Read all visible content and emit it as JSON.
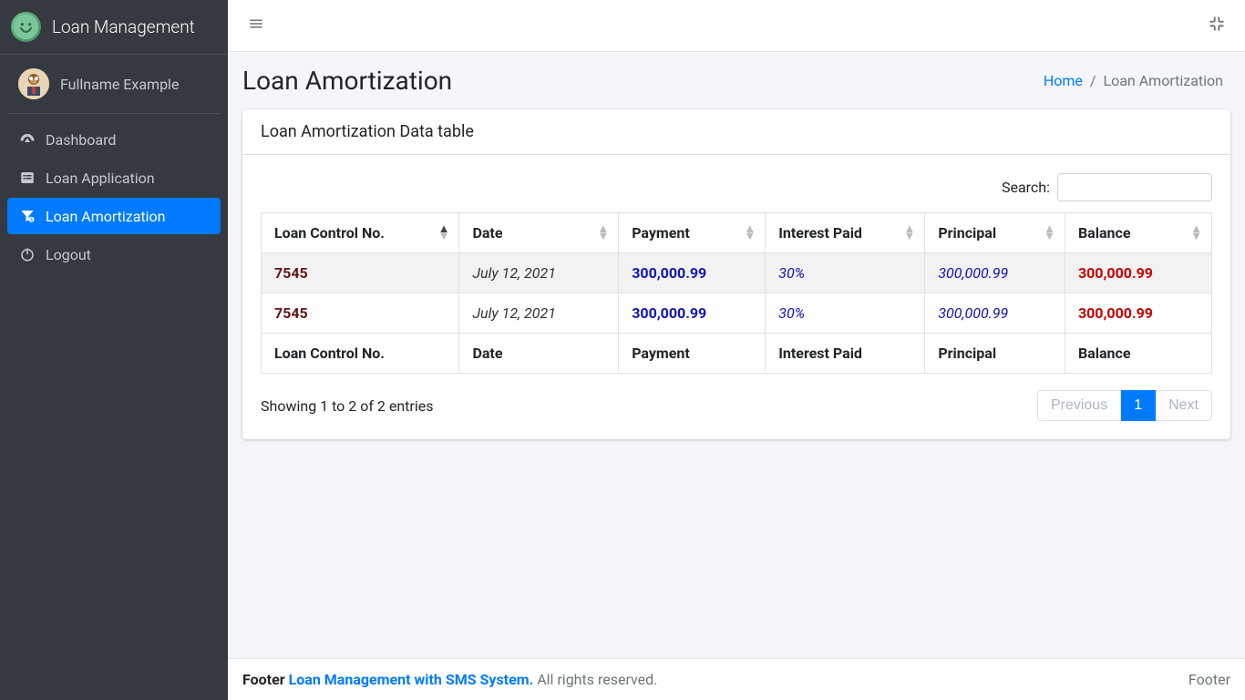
{
  "brand": {
    "name": "Loan Management"
  },
  "user": {
    "fullname": "Fullname Example"
  },
  "sidebar": {
    "items": [
      {
        "label": "Dashboard"
      },
      {
        "label": "Loan Application"
      },
      {
        "label": "Loan Amortization"
      },
      {
        "label": "Logout"
      }
    ]
  },
  "header": {
    "title": "Loan Amortization",
    "breadcrumb_home": "Home",
    "breadcrumb_current": "Loan Amortization"
  },
  "card": {
    "title": "Loan Amortization Data table"
  },
  "datatable": {
    "search_label": "Search:",
    "columns": [
      "Loan Control No.",
      "Date",
      "Payment",
      "Interest Paid",
      "Principal",
      "Balance"
    ],
    "rows": [
      {
        "control": "7545",
        "date": "July 12, 2021",
        "payment": "300,000.99",
        "interest": "30%",
        "principal": "300,000.99",
        "balance": "300,000.99"
      },
      {
        "control": "7545",
        "date": "July 12, 2021",
        "payment": "300,000.99",
        "interest": "30%",
        "principal": "300,000.99",
        "balance": "300,000.99"
      }
    ],
    "info": "Showing 1 to 2 of 2 entries",
    "pagination": {
      "previous": "Previous",
      "page": "1",
      "next": "Next"
    }
  },
  "footer": {
    "left_prefix": "Footer ",
    "left_link": "Loan Management with SMS System.",
    "left_suffix": " All rights reserved.",
    "right": "Footer"
  }
}
